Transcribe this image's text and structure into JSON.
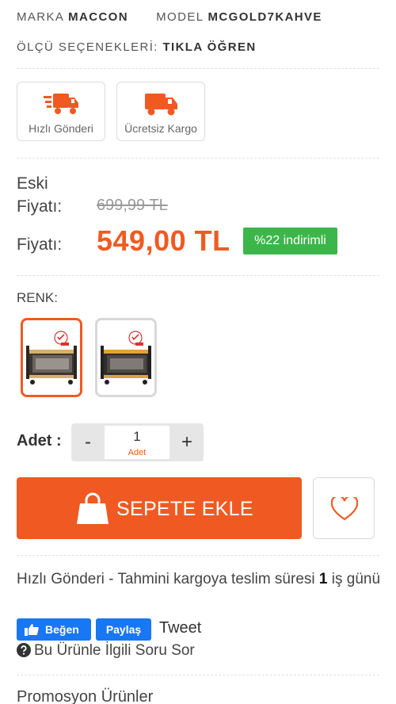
{
  "brand": {
    "label": "MARKA",
    "value": "MACCON"
  },
  "model": {
    "label": "MODEL",
    "value": "MCGOLD7KAHVE"
  },
  "size_options": {
    "label": "ÖLÇÜ SEÇENEKLERİ:",
    "link": "TIKLA ÖĞREN"
  },
  "shipping_badges": [
    {
      "label": "Hızlı Gönderi",
      "icon": "fast-truck-icon"
    },
    {
      "label": "Ücretsiz Kargo",
      "icon": "truck-icon"
    }
  ],
  "pricing": {
    "old_label": "Eski Fiyatı:",
    "old_price": "699,99 TL",
    "price_label": "Fiyatı:",
    "price": "549,00 TL",
    "discount": "%22 indirimli"
  },
  "color_section": {
    "label": "RENK:",
    "options": [
      {
        "name": "color-option-1",
        "selected": true
      },
      {
        "name": "color-option-2",
        "selected": false
      }
    ]
  },
  "quantity": {
    "label": "Adet :",
    "minus": "-",
    "value": "1",
    "unit": "Adet",
    "plus": "+"
  },
  "cart": {
    "button_label": "SEPETE EKLE",
    "favorite_icon": "heart-icon"
  },
  "delivery": {
    "text_before": "Hızlı Gönderi - Tahmini kargoya teslim süresi ",
    "days": "1",
    "text_after": " iş günü"
  },
  "social": {
    "like": "Beğen",
    "share": "Paylaş",
    "tweet": "Tweet"
  },
  "ask_question": "Bu Ürünle İlgili Soru Sor",
  "promo_heading": "Promosyon Ürünler",
  "colors": {
    "accent": "#f05a22",
    "discount_bg": "#3cb64a",
    "facebook": "#1877f2"
  }
}
